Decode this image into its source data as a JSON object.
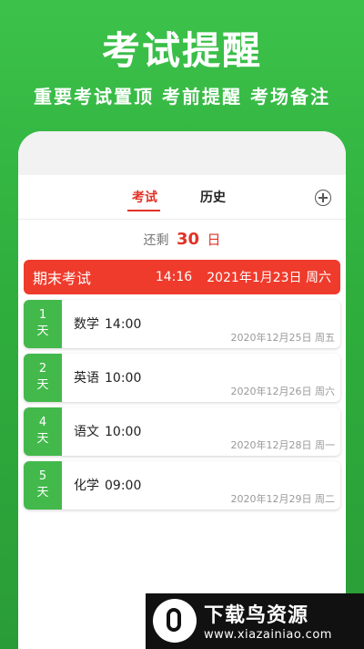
{
  "promo": {
    "title": "考试提醒",
    "subtitle": "重要考试置顶  考前提醒  考场备注"
  },
  "tabs": {
    "exam": "考试",
    "history": "历史"
  },
  "remaining": {
    "prefix": "还剩",
    "days": "30",
    "unit": "日"
  },
  "main_exam": {
    "name": "期末考试",
    "time": "14:16",
    "date": "2021年1月23日 周六"
  },
  "exams": [
    {
      "days": "1",
      "unit": "天",
      "subject": "数学",
      "time": "14:00",
      "date": "2020年12月25日 周五"
    },
    {
      "days": "2",
      "unit": "天",
      "subject": "英语",
      "time": "10:00",
      "date": "2020年12月26日 周六"
    },
    {
      "days": "4",
      "unit": "天",
      "subject": "语文",
      "time": "10:00",
      "date": "2020年12月28日 周一"
    },
    {
      "days": "5",
      "unit": "天",
      "subject": "化学",
      "time": "09:00",
      "date": "2020年12月29日 周二"
    }
  ],
  "watermark": {
    "title": "下载鸟资源",
    "url": "www.xiazainiao.com"
  },
  "colors": {
    "background": "#2fae3d",
    "accent_red": "#ef3b2c",
    "badge_green": "#43b94c"
  }
}
